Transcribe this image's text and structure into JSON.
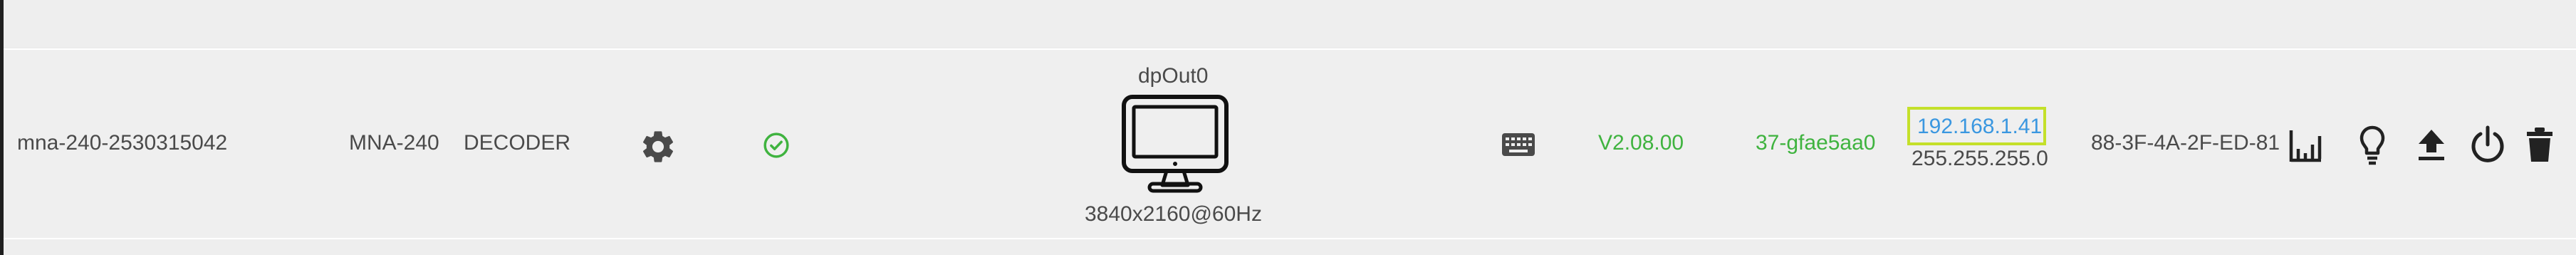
{
  "device": {
    "hostname": "mna-240-2530315042",
    "model": "MNA-240",
    "role": "DECODER",
    "output": {
      "name": "dpOut0",
      "resolution": "3840x2160@60Hz"
    },
    "firmware": "V2.08.00",
    "build": "37-gfae5aa0",
    "ip": "192.168.1.41",
    "netmask": "255.255.255.0",
    "mac": "88-3F-4A-2F-ED-81"
  },
  "icons": {
    "settings": "gear-icon",
    "status": "check-circle-icon",
    "display": "monitor-icon",
    "keyboard": "keyboard-icon",
    "stats": "bar-chart-icon",
    "identify": "lightbulb-icon",
    "upload": "upload-icon",
    "power": "power-icon",
    "delete": "trash-icon"
  },
  "colors": {
    "status_ok": "#3fb33f",
    "link": "#3a97e0",
    "highlight": "#c4e02a"
  }
}
